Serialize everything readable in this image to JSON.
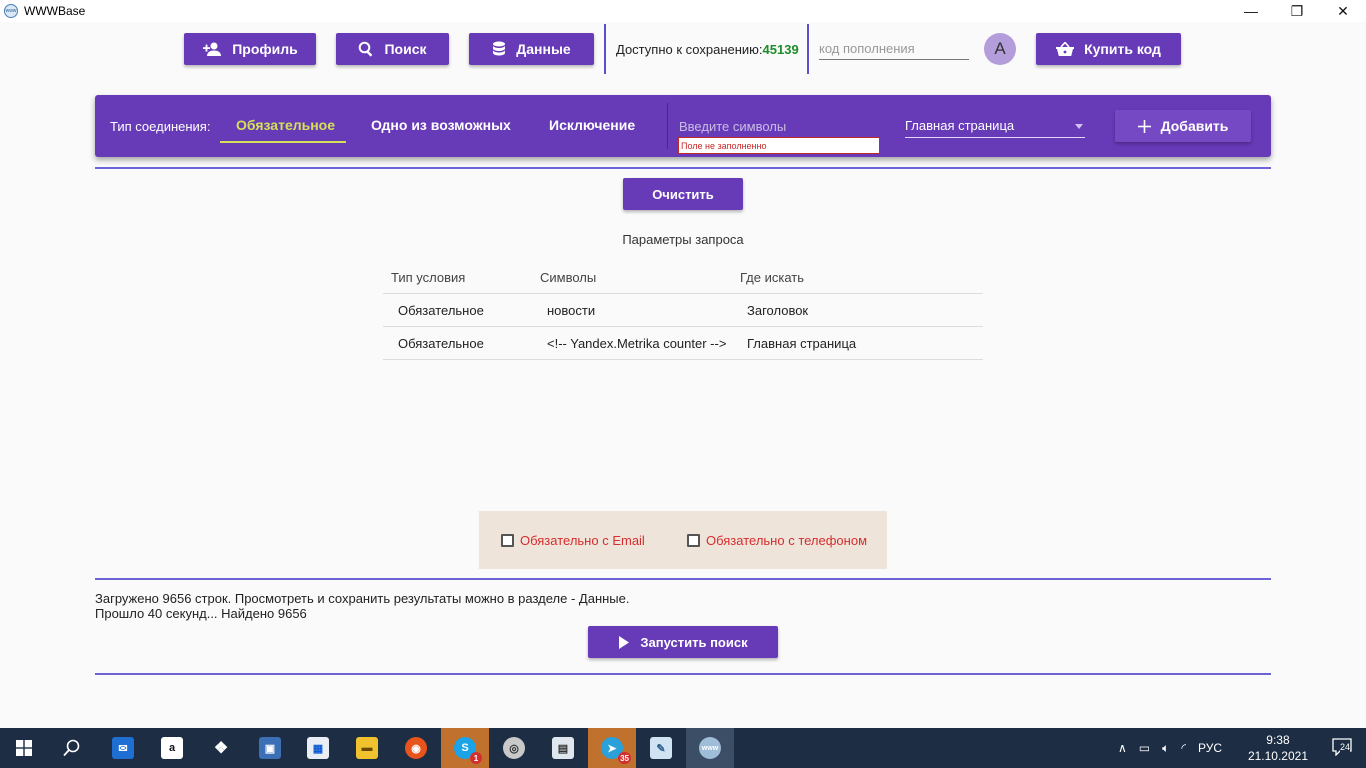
{
  "window": {
    "title": "WWWBase",
    "icon_text": "www",
    "minimize": "—",
    "restore": "❐",
    "close": "✕"
  },
  "toolbar": {
    "profile_label": "Профиль",
    "search_label": "Поиск",
    "data_label": "Данные",
    "available_label": "Доступно к сохранению:",
    "available_value": "45139",
    "code_placeholder": "код пополнения",
    "avatar_letter": "A",
    "buy_label": "Купить код"
  },
  "filter": {
    "connection_label": "Тип соединения:",
    "tabs": [
      {
        "label": "Обязательное",
        "active": true
      },
      {
        "label": "Одно из возможных",
        "active": false
      },
      {
        "label": "Исключение",
        "active": false
      }
    ],
    "input_placeholder": "Введите символы",
    "error_text": "Поле не заполненно",
    "select_value": "Главная страница",
    "add_label": "Добавить"
  },
  "clear_label": "Очистить",
  "params": {
    "title": "Параметры запроса",
    "headers": [
      "Тип условия",
      "Символы",
      "Где искать"
    ],
    "rows": [
      [
        "Обязательное",
        "новости",
        "Заголовок"
      ],
      [
        "Обязательное",
        "<!-- Yandex.Metrika counter -->",
        "Главная страница"
      ]
    ]
  },
  "checks": {
    "email_label": "Обязательно с Email",
    "phone_label": "Обязательно с телефоном",
    "email_checked": false,
    "phone_checked": false
  },
  "status": {
    "line1": "Загружено 9656 строк. Просмотреть и сохранить результаты можно в разделе - Данные.",
    "line2": "Прошло 40 секунд... Найдено 9656"
  },
  "run_label": "Запустить поиск",
  "taskbar": {
    "lang": "РУС",
    "time": "9:38",
    "date": "21.10.2021",
    "notifications": "24",
    "skype_badge": "1",
    "telegram_badge": "35",
    "colors": {
      "bar": "#1c2d44",
      "highlight": "#c0712e",
      "accent": "#673ab7"
    }
  }
}
